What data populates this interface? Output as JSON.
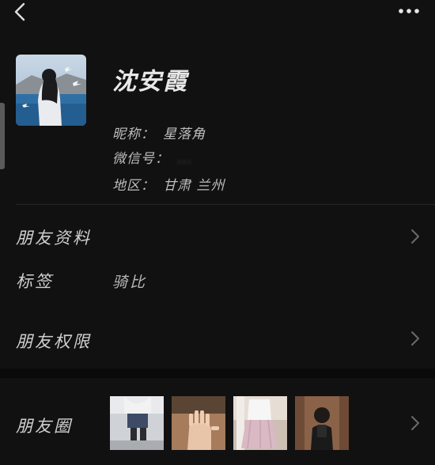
{
  "header": {
    "back_icon": "chevron-left-icon",
    "more_icon": "more-dots-icon"
  },
  "profile": {
    "name": "沈安霞",
    "nickname_label": "昵称：",
    "nickname": "星落角",
    "wechat_label": "微信号：",
    "wechat_id": "...",
    "region_label": "地区：",
    "region": "甘肃  兰州"
  },
  "rows": {
    "friend_info": "朋友资料",
    "tags_label": "标签",
    "tags_value": "骑比",
    "friend_permissions": "朋友权限",
    "moments": "朋友圈"
  },
  "colors": {
    "background": "#111111",
    "divider": "#262626",
    "text": "#d0d0d0"
  }
}
